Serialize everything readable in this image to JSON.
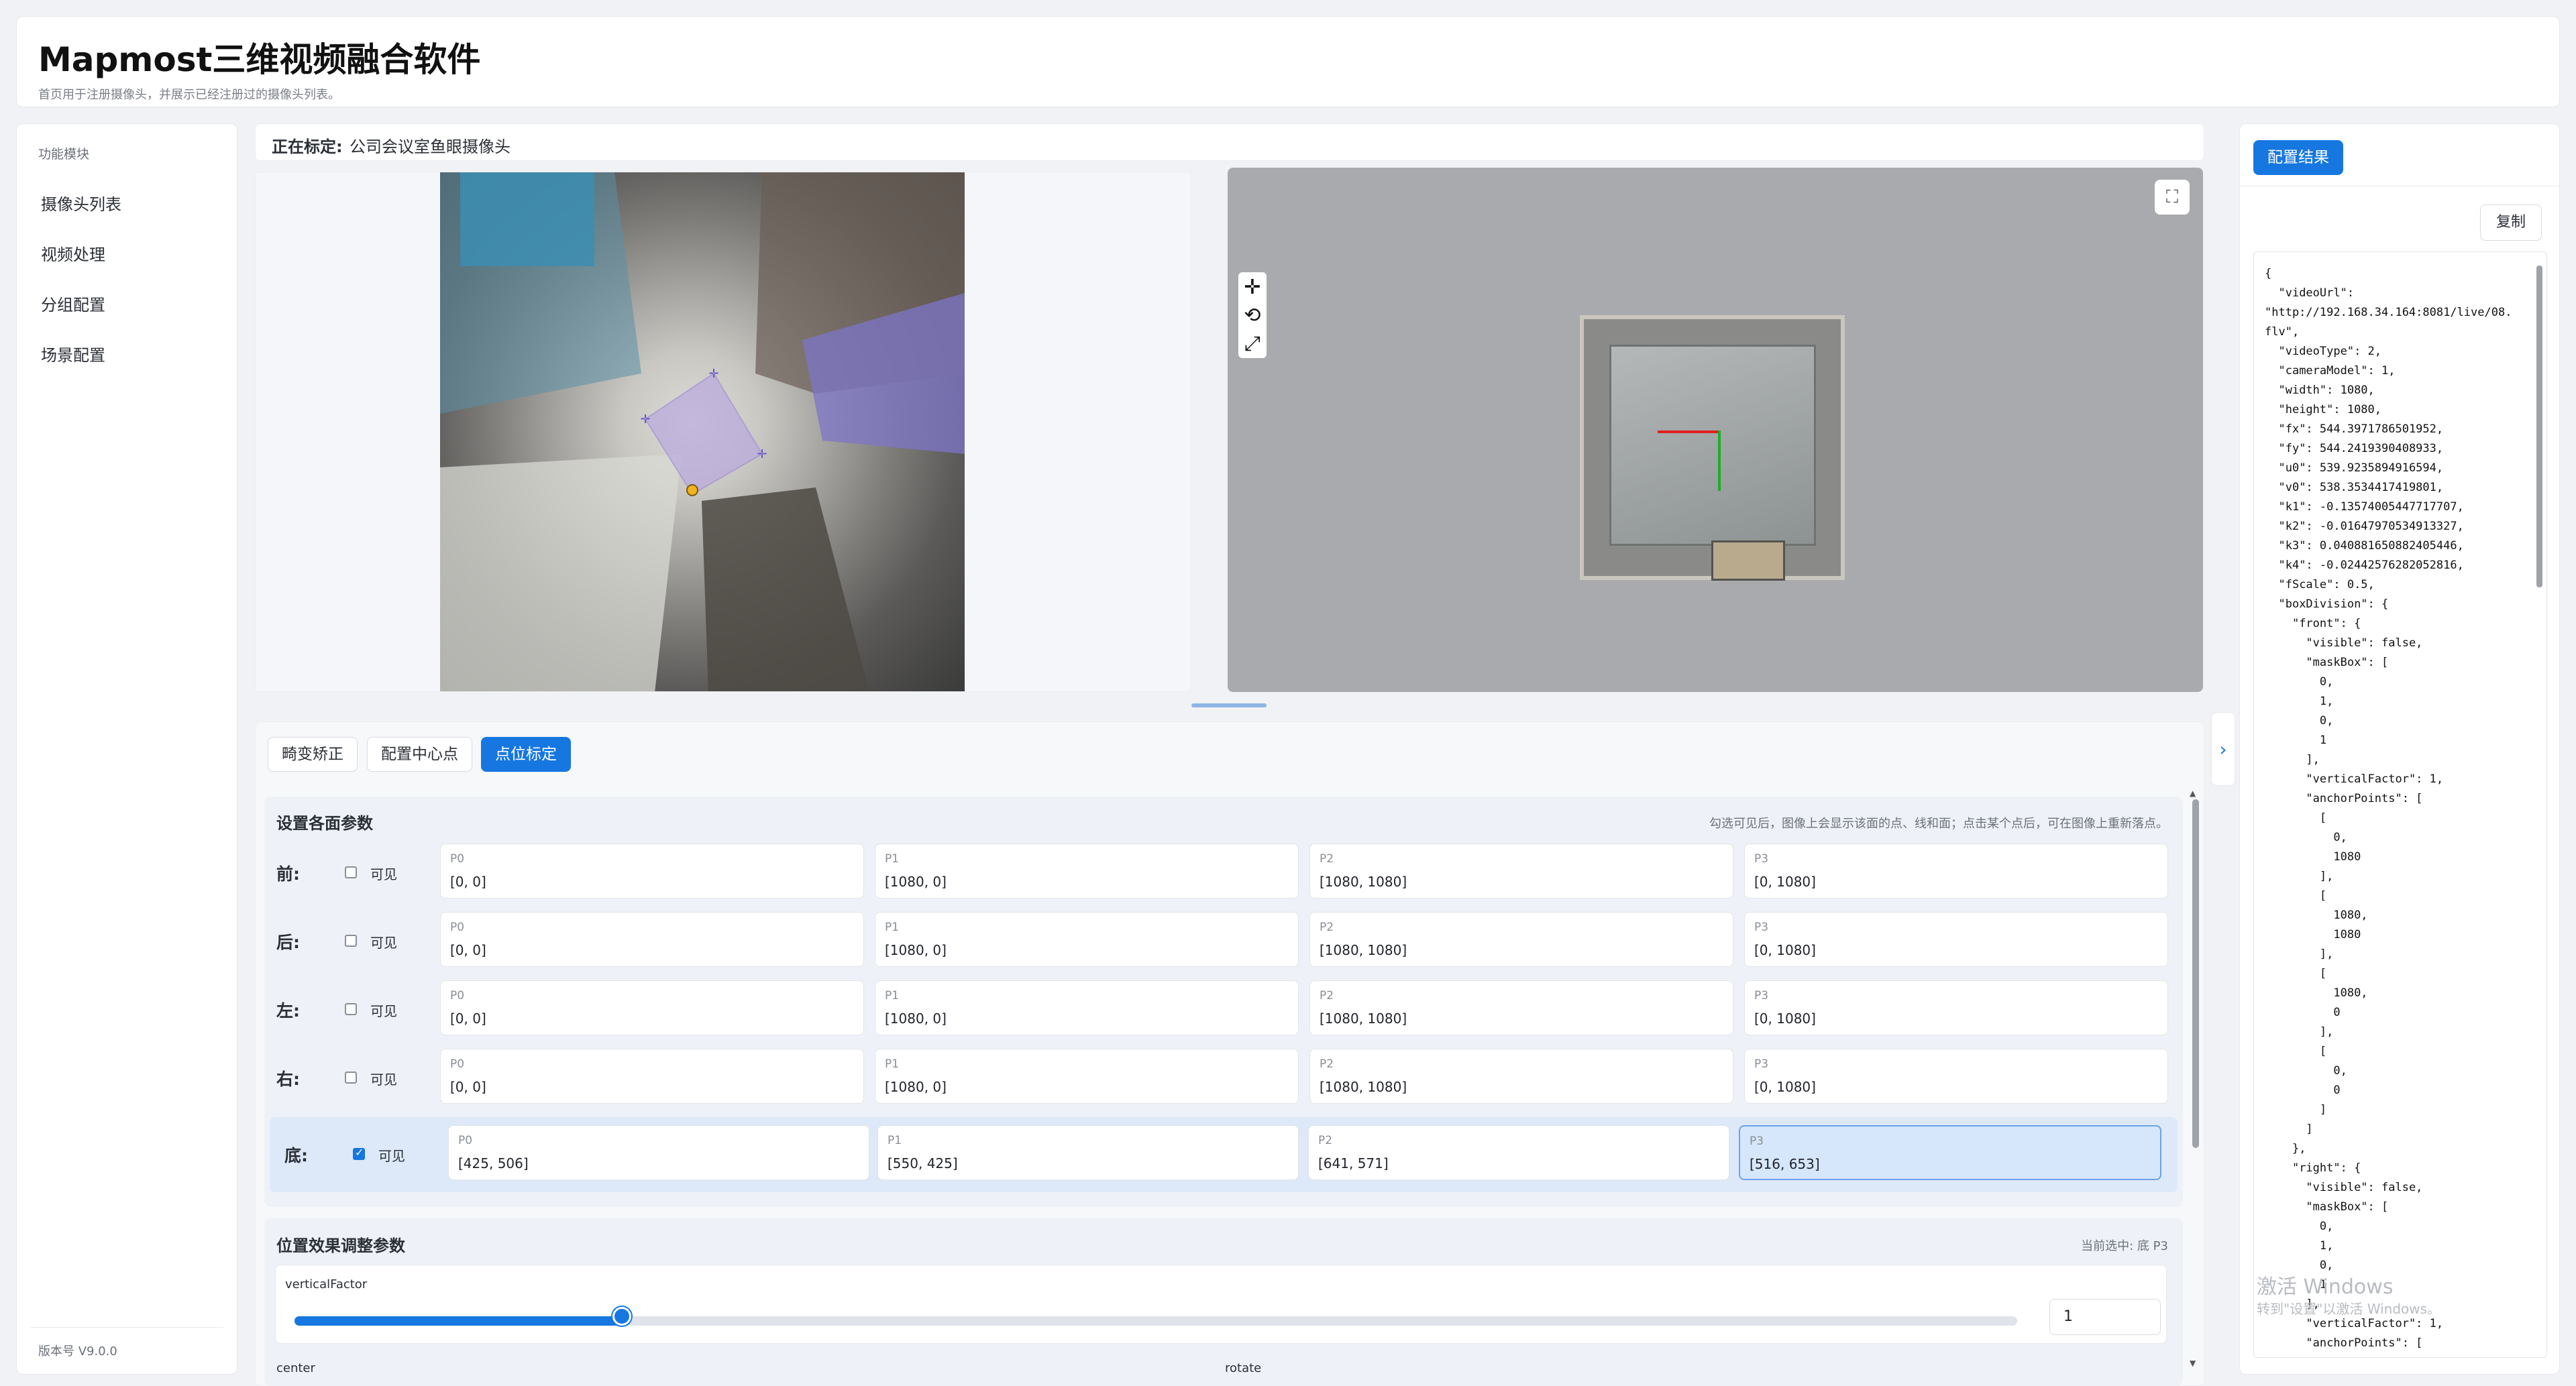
{
  "header": {
    "title": "Mapmost三维视频融合软件",
    "subtitle": "首页用于注册摄像头，并展示已经注册过的摄像头列表。"
  },
  "sidebar": {
    "section_title": "功能模块",
    "items": [
      {
        "label": "摄像头列表"
      },
      {
        "label": "视频处理"
      },
      {
        "label": "分组配置"
      },
      {
        "label": "场景配置"
      }
    ],
    "version": "版本号 V9.0.0"
  },
  "calibration": {
    "label": "正在标定:",
    "camera_name": "公司会议室鱼眼摄像头"
  },
  "tabs": [
    {
      "label": "畸变矫正",
      "active": false
    },
    {
      "label": "配置中心点",
      "active": false
    },
    {
      "label": "点位标定",
      "active": true
    }
  ],
  "params": {
    "title": "设置各面参数",
    "hint": "勾选可见后，图像上会显示该面的点、线和面；点击某个点后，可在图像上重新落点。",
    "visible_label": "可见",
    "rows": [
      {
        "label": "前:",
        "visible": false,
        "points": [
          {
            "name": "P0",
            "value": "[0, 0]"
          },
          {
            "name": "P1",
            "value": "[1080, 0]"
          },
          {
            "name": "P2",
            "value": "[1080, 1080]"
          },
          {
            "name": "P3",
            "value": "[0, 1080]"
          }
        ]
      },
      {
        "label": "后:",
        "visible": false,
        "points": [
          {
            "name": "P0",
            "value": "[0, 0]"
          },
          {
            "name": "P1",
            "value": "[1080, 0]"
          },
          {
            "name": "P2",
            "value": "[1080, 1080]"
          },
          {
            "name": "P3",
            "value": "[0, 1080]"
          }
        ]
      },
      {
        "label": "左:",
        "visible": false,
        "points": [
          {
            "name": "P0",
            "value": "[0, 0]"
          },
          {
            "name": "P1",
            "value": "[1080, 0]"
          },
          {
            "name": "P2",
            "value": "[1080, 1080]"
          },
          {
            "name": "P3",
            "value": "[0, 1080]"
          }
        ]
      },
      {
        "label": "右:",
        "visible": false,
        "points": [
          {
            "name": "P0",
            "value": "[0, 0]"
          },
          {
            "name": "P1",
            "value": "[1080, 0]"
          },
          {
            "name": "P2",
            "value": "[1080, 1080]"
          },
          {
            "name": "P3",
            "value": "[0, 1080]"
          }
        ]
      },
      {
        "label": "底:",
        "visible": true,
        "points": [
          {
            "name": "P0",
            "value": "[425, 506]"
          },
          {
            "name": "P1",
            "value": "[550, 425]"
          },
          {
            "name": "P2",
            "value": "[641, 571]"
          },
          {
            "name": "P3",
            "value": "[516, 653]"
          }
        ]
      }
    ]
  },
  "position": {
    "title": "位置效果调整参数",
    "selected": "当前选中: 底 P3",
    "slider_label": "verticalFactor",
    "slider_value": "1",
    "slider_level": 0.19,
    "center_label": "center",
    "rotate_label": "rotate"
  },
  "result": {
    "tab_label": "配置结果",
    "copy_label": "复制",
    "json_text": "{\n  \"videoUrl\":\n\"http://192.168.34.164:8081/live/08.flv\",\n  \"videoType\": 2,\n  \"cameraModel\": 1,\n  \"width\": 1080,\n  \"height\": 1080,\n  \"fx\": 544.3971786501952,\n  \"fy\": 544.2419390408933,\n  \"u0\": 539.9235894916594,\n  \"v0\": 538.3534417419801,\n  \"k1\": -0.13574005447717707,\n  \"k2\": -0.01647970534913327,\n  \"k3\": 0.040881650882405446,\n  \"k4\": -0.02442576282052816,\n  \"fScale\": 0.5,\n  \"boxDivision\": {\n    \"front\": {\n      \"visible\": false,\n      \"maskBox\": [\n        0,\n        1,\n        0,\n        1\n      ],\n      \"verticalFactor\": 1,\n      \"anchorPoints\": [\n        [\n          0,\n          1080\n        ],\n        [\n          1080,\n          1080\n        ],\n        [\n          1080,\n          0\n        ],\n        [\n          0,\n          0\n        ]\n      ]\n    },\n    \"right\": {\n      \"visible\": false,\n      \"maskBox\": [\n        0,\n        1,\n        0,\n        1\n      ],\n      \"verticalFactor\": 1,\n      \"anchorPoints\": ["
  },
  "watermark": {
    "title": "激活 Windows",
    "subtitle": "转到\"设置\"以激活 Windows。"
  },
  "icons": {
    "toolbox": [
      "move-icon",
      "rotate-icon",
      "scale-icon"
    ],
    "fullscreen": "fullscreen-icon",
    "collapse": "chevron-right-icon"
  },
  "colors": {
    "accent": "#1677e0",
    "selected_surface": "#d6e6fb"
  }
}
